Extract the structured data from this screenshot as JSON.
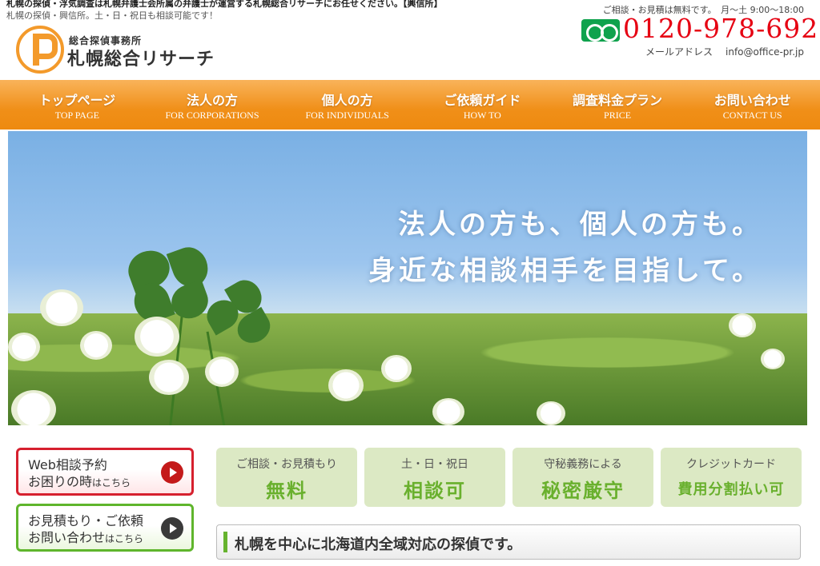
{
  "header": {
    "topline": "札幌の探偵・浮気調査は札幌弁護士会所属の弁護士が運営する札幌総合リサーチにお任せください。【興信所】",
    "subline": "札幌の探偵・興信所。土・日・祝日も相談可能です！",
    "logo_sub": "総合探偵事務所",
    "logo_title": "札幌総合リサーチ",
    "contact_note": "ご相談・お見積は無料です。　月〜土 9:00〜18:00",
    "phone": "0120-978-692",
    "mail_label": "メールアドレス",
    "mail": "info@office-pr.jp"
  },
  "nav": [
    {
      "jp": "トップページ",
      "en": "TOP PAGE"
    },
    {
      "jp": "法人の方",
      "en": "FOR CORPORATIONS"
    },
    {
      "jp": "個人の方",
      "en": "FOR INDIVIDUALS"
    },
    {
      "jp": "ご依頼ガイド",
      "en": "HOW TO"
    },
    {
      "jp": "調査料金プラン",
      "en": "PRICE"
    },
    {
      "jp": "お問い合わせ",
      "en": "CONTACT US"
    }
  ],
  "hero": {
    "line1": "法人の方も、個人の方も。",
    "line2": "身近な相談相手を目指して。"
  },
  "side": {
    "web_l1": "Web相談予約",
    "web_l2": "お困りの時",
    "web_l2_small": "はこちら",
    "estimate_l1": "お見積もり・ご依頼",
    "estimate_l2": "お問い合わせ",
    "estimate_l2_small": "はこちら"
  },
  "features": [
    {
      "top": "ご相談・お見積もり",
      "main": "無料"
    },
    {
      "top": "土・日・祝日",
      "main": "相談可"
    },
    {
      "top": "守秘義務による",
      "main": "秘密厳守"
    },
    {
      "top": "クレジットカード",
      "main": "費用分割払い可"
    }
  ],
  "section_title": "札幌を中心に北海道内全域対応の探偵です。",
  "colors": {
    "accent_orange": "#f08f18",
    "phone_red": "#e60012",
    "free_dial_green": "#0fa24d",
    "feature_green": "#69b02d"
  },
  "icons": [
    "free-dial-icon",
    "logo-mark-icon",
    "arrow-right-icon"
  ]
}
